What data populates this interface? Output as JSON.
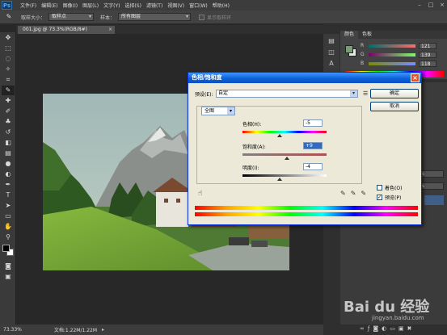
{
  "app": {
    "logo": "Ps",
    "menu": [
      "文件(F)",
      "编辑(E)",
      "图像(I)",
      "图层(L)",
      "文字(Y)",
      "选择(S)",
      "滤镜(T)",
      "视图(V)",
      "窗口(W)",
      "帮助(H)"
    ],
    "window_controls": [
      "–",
      "□",
      "×"
    ]
  },
  "options_bar": {
    "sample_size_label": "取样大小：",
    "sample_size_value": "取样点",
    "sample_label": "样本：",
    "sample_value": "所有图层",
    "show_ring_label": "显示取样环"
  },
  "document": {
    "tab_title": "001.jpg @ 73.3%(RGB/8#)",
    "tab_close": "×"
  },
  "status": {
    "zoom": "73.33%",
    "doc_info": "文档:1.22M/1.22M",
    "arrow": "▸"
  },
  "color_panel": {
    "tabs": [
      "颜色",
      "色板"
    ],
    "channels": [
      {
        "label": "R",
        "value": "121",
        "gradient": "linear-gradient(to right,#006d6a,#ff6d6a)"
      },
      {
        "label": "G",
        "value": "139",
        "gradient": "linear-gradient(to right,#7a006a,#7aff6a)"
      },
      {
        "label": "B",
        "value": "118",
        "gradient": "linear-gradient(to right,#7a8b00,#7a8bff)"
      }
    ]
  },
  "right_fields": [
    "100%",
    "100%"
  ],
  "watermark": {
    "text": "Bai du 经验",
    "sub": "jingyan.baidu.com"
  },
  "dialog": {
    "title": "色相/饱和度",
    "close": "×",
    "preset_label": "预设(E):",
    "preset_value": "自定",
    "ok_label": "确定",
    "cancel_label": "取消",
    "channel_value": "全图",
    "hue_label": "色相(H):",
    "hue_value": "-5",
    "saturation_label": "饱和度(A):",
    "saturation_value": "+9",
    "lightness_label": "明度(I):",
    "lightness_value": "-4",
    "colorize_label": "着色(O)",
    "colorize_checked": false,
    "preview_label": "预览(P)",
    "preview_checked": true,
    "preview_check_mark": "✓"
  }
}
